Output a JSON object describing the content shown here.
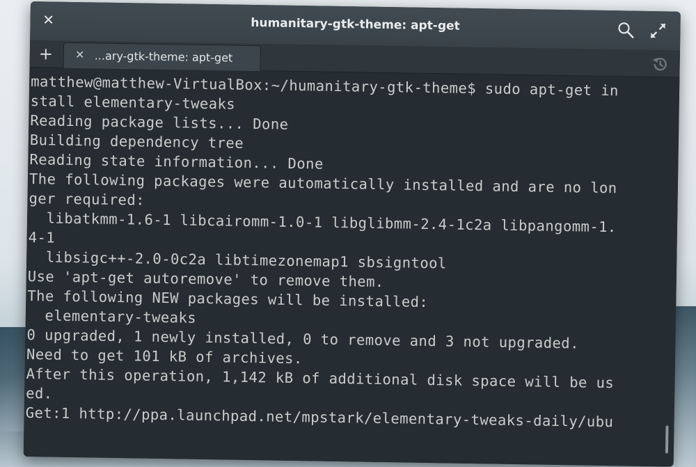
{
  "window": {
    "title": "humanitary-gtk-theme: apt-get",
    "close_glyph": "✕",
    "icons": {
      "search": "search-icon",
      "maximize": "maximize-icon",
      "history": "history-icon"
    }
  },
  "tabbar": {
    "new_tab_glyph": "+",
    "tabs": [
      {
        "close_glyph": "✕",
        "label": "...ary-gtk-theme: apt-get"
      }
    ]
  },
  "terminal": {
    "lines": [
      "matthew@matthew-VirtualBox:~/humanitary-gtk-theme$ sudo apt-get in",
      "stall elementary-tweaks",
      "Reading package lists... Done",
      "Building dependency tree",
      "Reading state information... Done",
      "The following packages were automatically installed and are no lon",
      "ger required:",
      "  libatkmm-1.6-1 libcairomm-1.0-1 libglibmm-2.4-1c2a libpangomm-1.",
      "4-1",
      "  libsigc++-2.0-0c2a libtimezonemap1 sbsigntool",
      "Use 'apt-get autoremove' to remove them.",
      "The following NEW packages will be installed:",
      "  elementary-tweaks",
      "0 upgraded, 1 newly installed, 0 to remove and 3 not upgraded.",
      "Need to get 101 kB of archives.",
      "After this operation, 1,142 kB of additional disk space will be us",
      "ed.",
      "Get:1 http://ppa.launchpad.net/mpstark/elementary-tweaks-daily/ubu"
    ]
  },
  "colors": {
    "terminal_bg": "#252d33",
    "terminal_fg": "#c9ccc9",
    "titlebar_bg": "#3d464c"
  }
}
